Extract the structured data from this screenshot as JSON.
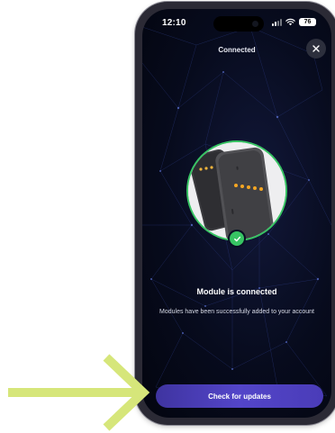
{
  "status_bar": {
    "time": "12:10",
    "battery": "76",
    "icons": [
      "signal-icon",
      "wifi-icon",
      "battery-icon"
    ]
  },
  "header": {
    "title": "Connected",
    "close_icon": "close-icon"
  },
  "content": {
    "title": "Module is connected",
    "message": "Modules have been successfully added to your account"
  },
  "button": {
    "label": "Check for updates"
  },
  "annotation": {
    "icon": "arrow-right-icon",
    "color": "#d6e67a"
  },
  "colors": {
    "success": "#37c463",
    "button": "#4f42c2",
    "background": "#070b1d"
  }
}
